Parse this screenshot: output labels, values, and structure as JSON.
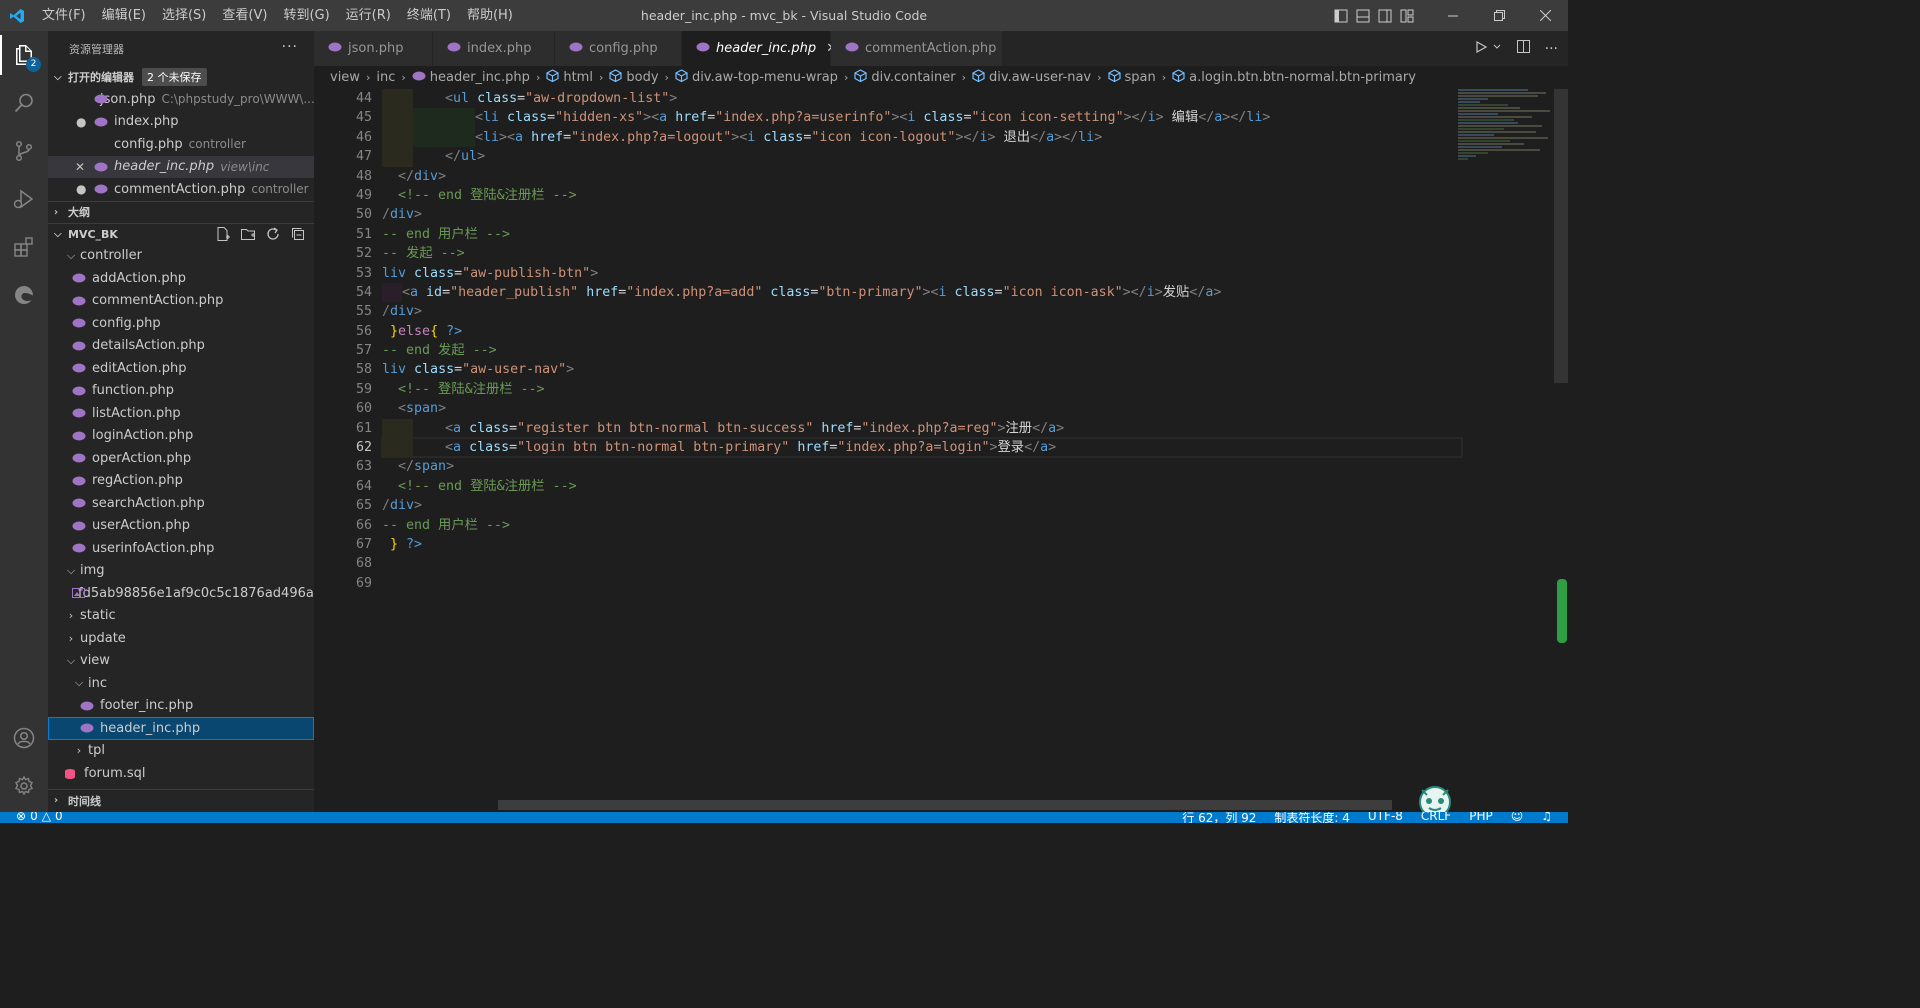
{
  "window": {
    "title": "header_inc.php - mvc_bk - Visual Studio Code",
    "menu": [
      "文件(F)",
      "编辑(E)",
      "选择(S)",
      "查看(V)",
      "转到(G)",
      "运行(R)",
      "终端(T)",
      "帮助(H)"
    ]
  },
  "activity": {
    "explorer_badge": "2"
  },
  "sidebar": {
    "header": "资源管理器",
    "open_editors": {
      "label": "打开的编辑器",
      "unsaved": "2 个未保存",
      "items": [
        {
          "name": "json.php",
          "desc": "C:\\phpstudy_pro\\WWW\\..."
        },
        {
          "name": "index.php",
          "desc": ""
        },
        {
          "name": "config.php",
          "desc": "controller"
        },
        {
          "name": "header_inc.php",
          "desc": "view\\inc"
        },
        {
          "name": "commentAction.php",
          "desc": "controller"
        }
      ]
    },
    "outline_label": "大纲",
    "project_label": "MVC_BK",
    "tree": {
      "controller": "controller",
      "controller_files": [
        "addAction.php",
        "commentAction.php",
        "config.php",
        "detailsAction.php",
        "editAction.php",
        "function.php",
        "listAction.php",
        "loginAction.php",
        "operAction.php",
        "regAction.php",
        "searchAction.php",
        "userAction.php",
        "userinfoAction.php"
      ],
      "img": "img",
      "img_file": "fd5ab98856e1af9c0c5c1876ad496a...",
      "static": "static",
      "update": "update",
      "view": "view",
      "inc": "inc",
      "inc_files": [
        "footer_inc.php",
        "header_inc.php"
      ],
      "tpl": "tpl",
      "sql": "forum.sql"
    },
    "timeline_label": "时间线"
  },
  "tabs": [
    {
      "label": "json.php"
    },
    {
      "label": "index.php"
    },
    {
      "label": "config.php"
    },
    {
      "label": "header_inc.php"
    },
    {
      "label": "commentAction.php"
    }
  ],
  "breadcrumb": [
    "view",
    "inc",
    "header_inc.php",
    "html",
    "body",
    "div.aw-top-menu-wrap",
    "div.container",
    "div.aw-user-nav",
    "span",
    "a.login.btn.btn-normal.btn-primary"
  ],
  "editor": {
    "line_numbers": [
      "44",
      "45",
      "46",
      "47",
      "48",
      "49",
      "50",
      "51",
      "52",
      "53",
      "54",
      "55",
      "56",
      "57",
      "58",
      "59",
      "60",
      "61",
      "62",
      "63",
      "64",
      "65",
      "66",
      "67",
      "68",
      "69"
    ],
    "current_line": "62",
    "text": {
      "edit": "编辑",
      "logout": "退出",
      "c_login_end": "<!-- end 登陆&注册栏 -->",
      "c_user_end": "-- end 用户栏 -->",
      "c_publish": "-- 发起 -->",
      "publish_text": "发贴",
      "c_publish_end": "-- end 发起 -->",
      "c_login_begin": "<!-- 登陆&注册栏 -->",
      "register_text": "注册",
      "login_text": "登录"
    }
  },
  "statusbar": {
    "errors": "0",
    "warnings": "0",
    "position": "行 62，列 92",
    "tab_size": "制表符长度: 4",
    "encoding": "UTF-8",
    "eol": "CRLF",
    "language": "PHP"
  }
}
